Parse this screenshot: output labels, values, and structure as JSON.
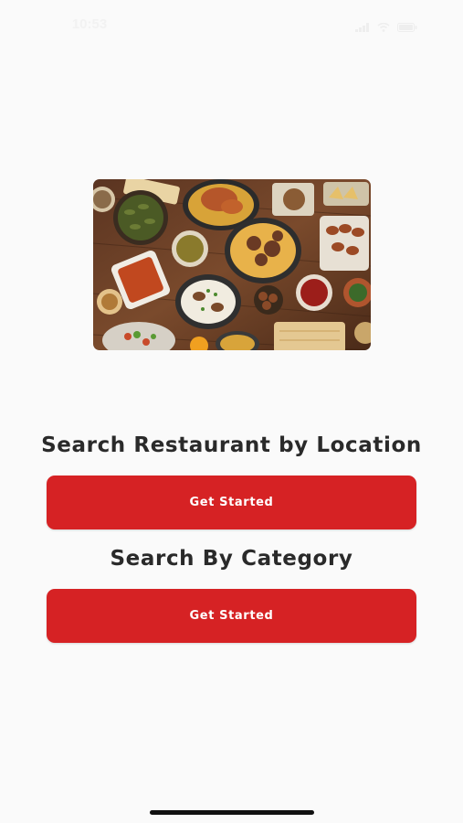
{
  "status_bar": {
    "time": "10:53",
    "icons": [
      "cellular-signal-icon",
      "wifi-icon",
      "battery-icon"
    ]
  },
  "hero_image": {
    "description_icon": "food-spread-image"
  },
  "location_section": {
    "heading": "Search Restaurant by Location",
    "button_label": "Get Started"
  },
  "category_section": {
    "heading": "Search By Category",
    "button_label": "Get Started"
  },
  "colors": {
    "accent": "#d62224",
    "background": "#fafafa",
    "heading_text": "#2a2a2a"
  }
}
